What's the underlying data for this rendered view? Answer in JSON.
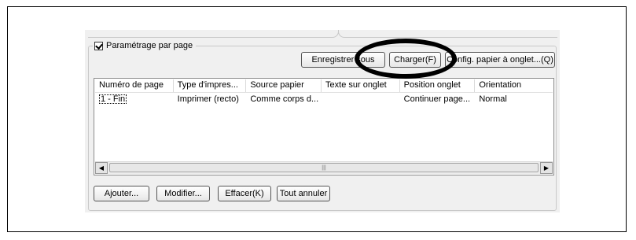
{
  "section": {
    "checkbox_label": "Paramétrage par page",
    "checked": true
  },
  "top_buttons": {
    "save_as": "Enregistrer sous",
    "load": "Charger(F)",
    "tab_config": "Config. papier à onglet...(Q)"
  },
  "table": {
    "columns": [
      "Numéro de page",
      "Type d'impres...",
      "Source papier",
      "Texte sur onglet",
      "Position onglet",
      "Orientation"
    ],
    "rows": [
      {
        "page": "1 - Fin",
        "print_type": "Imprimer (recto)",
        "paper_source": "Comme corps d...",
        "tab_text": "",
        "tab_position": "Continuer page...",
        "orientation": "Normal"
      }
    ]
  },
  "bottom_buttons": {
    "add": "Ajouter...",
    "modify": "Modifier...",
    "delete": "Effacer(K)",
    "cancel_all": "Tout annuler"
  },
  "annotation": {
    "highlight_color": "#000000"
  }
}
